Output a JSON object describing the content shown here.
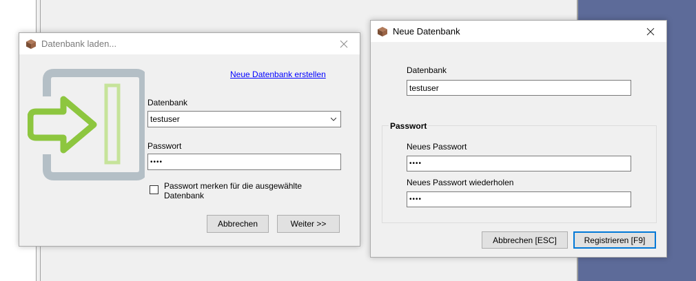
{
  "colors": {
    "desktop": "#5d6b99",
    "link": "#0000ff",
    "default_button_border": "#0078d7",
    "logo_green": "#8dc63f",
    "logo_gray": "#b4bfc6"
  },
  "load_dialog": {
    "title": "Datenbank laden...",
    "icon": "database-box-icon",
    "create_link": "Neue Datenbank erstellen",
    "database_label": "Datenbank",
    "database_value": "testuser",
    "password_label": "Passwort",
    "password_value": "••••",
    "remember_label_line1": "Passwort merken für die ausgewählte",
    "remember_label_line2": "Datenbank",
    "remember_checked": false,
    "cancel_label": "Abbrechen",
    "next_label": "Weiter >>",
    "logo": "login-arrow-icon"
  },
  "new_dialog": {
    "title": "Neue Datenbank",
    "icon": "database-box-icon",
    "database_label": "Datenbank",
    "database_value": "testuser",
    "password_group": "Passwort",
    "new_password_label": "Neues Passwort",
    "new_password_value": "••••",
    "repeat_password_label": "Neues Passwort wiederholen",
    "repeat_password_value": "••••",
    "cancel_label": "Abbrechen [ESC]",
    "register_label": "Registrieren [F9]"
  }
}
